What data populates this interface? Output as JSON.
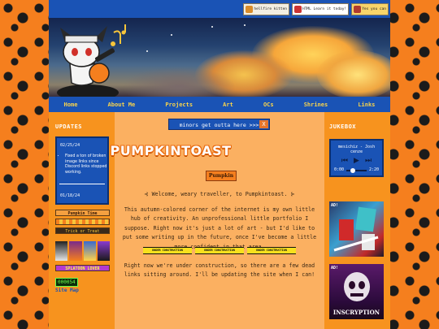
{
  "header": {
    "badges": [
      "hellfire kitten",
      "HTML Learn it today!",
      "Yes you can"
    ]
  },
  "nav": {
    "items": [
      "Home",
      "About Me",
      "Projects",
      "Art",
      "OCs",
      "Shrines",
      "Links"
    ]
  },
  "updates": {
    "heading": "UPDATES",
    "entries": [
      {
        "date": "02/25/24",
        "items": [
          "Fixed a ton of broken image links since Discord links stopped working."
        ]
      },
      {
        "date": "01/18/24",
        "items": []
      }
    ]
  },
  "stamps": {
    "pumpkin_time": "Pumpkin Time",
    "trick_or_treat": "Trick or Treat",
    "splatoon": "SPLATOON LOVER"
  },
  "counter": "000054",
  "sitemap": "Site Map",
  "minors_banner": {
    "text": "minors get outta here >>>",
    "close": "X"
  },
  "main": {
    "title": "PUMPKINTOAST",
    "badge": "Pumpkin",
    "welcome": "⊰ Welcome, weary traveller, to Pumpkintoast. ⊱",
    "para1": "This autumn-colored corner of the internet is my own little hub of creativity. An unprofessional little portfolio I suppose. Right now it's just a lot of art - but I'd like to put some writing up in the future, once I've become a little more confident in that area.",
    "under_construction": "UNDER CONSTRUCTION",
    "para2": "Right now we're under construction, so there are a few dead links sitting around. I'll be updating the site when I can!"
  },
  "jukebox": {
    "heading": "JUKEBOX",
    "song": "mesichiz - Josh cenze",
    "time_current": "0:00",
    "time_total": "2:20"
  },
  "ads": [
    {
      "label": "AD!",
      "title": ""
    },
    {
      "label": "AD!",
      "title": "INSCRYPTION"
    }
  ],
  "colors": {
    "accent": "#1a53b5",
    "orange": "#f7931e",
    "light_orange": "#fbb061",
    "nav_text": "#f7d24c"
  }
}
